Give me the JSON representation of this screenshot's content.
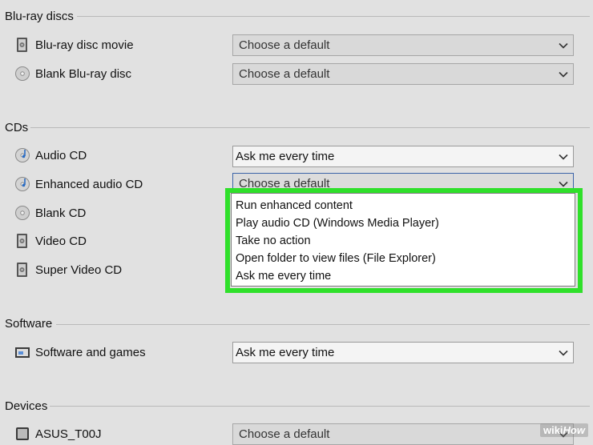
{
  "sections": {
    "bluray": "Blu-ray discs",
    "cds": "CDs",
    "software": "Software",
    "devices": "Devices"
  },
  "rows": {
    "bluray_movie": {
      "label": "Blu-ray disc movie",
      "value": "Choose a default",
      "icon": "bluray-disc-icon"
    },
    "blank_bluray": {
      "label": "Blank Blu-ray disc",
      "value": "Choose a default",
      "icon": "blank-disc-icon"
    },
    "audio_cd": {
      "label": "Audio CD",
      "value": "Ask me every time",
      "icon": "audio-cd-icon"
    },
    "enhanced_audio_cd": {
      "label": "Enhanced audio CD",
      "value": "Choose a default",
      "icon": "audio-cd-icon"
    },
    "blank_cd": {
      "label": "Blank CD",
      "icon": "blank-disc-icon"
    },
    "video_cd": {
      "label": "Video CD",
      "icon": "video-disc-icon"
    },
    "super_video_cd": {
      "label": "Super Video CD",
      "icon": "video-disc-icon"
    },
    "software_games": {
      "label": "Software and games",
      "value": "Ask me every time",
      "icon": "software-icon"
    },
    "asus_device": {
      "label": "ASUS_T00J",
      "value": "Choose a default",
      "icon": "device-icon"
    }
  },
  "dropdown_options": [
    "Run enhanced content",
    "Play audio CD (Windows Media Player)",
    "Take no action",
    "Open folder to view files (File Explorer)",
    "Ask me every time"
  ],
  "highlight_color": "#2fe02a",
  "watermark": {
    "wiki": "wiki",
    "how": "How"
  }
}
